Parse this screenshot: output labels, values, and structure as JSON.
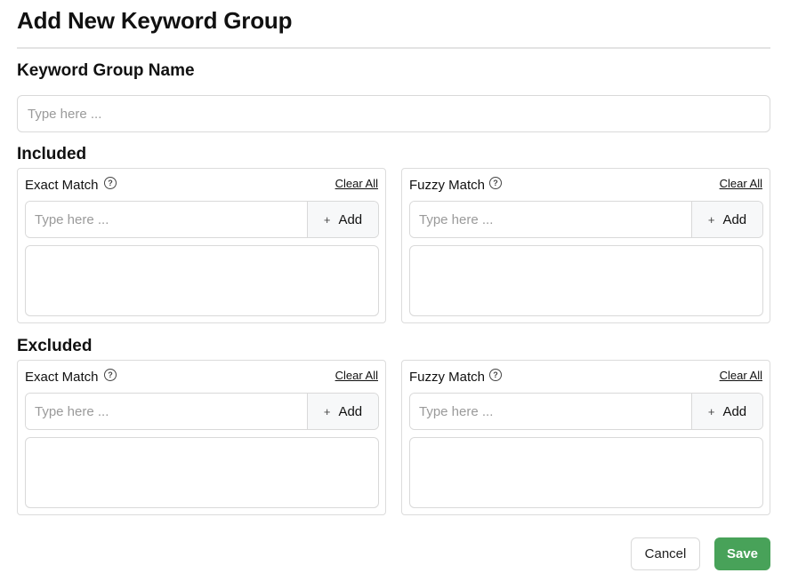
{
  "dialog": {
    "title": "Add New Keyword Group",
    "group_name_label": "Keyword Group Name",
    "group_name_placeholder": "Type here ...",
    "group_name_value": ""
  },
  "sections": {
    "included": {
      "title": "Included",
      "exact": {
        "title": "Exact Match",
        "help_icon": "question-circle-icon",
        "clear_label": "Clear All",
        "placeholder": "Type here ...",
        "add_label": "Add",
        "add_icon": "plus-icon"
      },
      "fuzzy": {
        "title": "Fuzzy Match",
        "help_icon": "question-circle-icon",
        "clear_label": "Clear All",
        "placeholder": "Type here ...",
        "add_label": "Add",
        "add_icon": "plus-icon"
      }
    },
    "excluded": {
      "title": "Excluded",
      "exact": {
        "title": "Exact Match",
        "help_icon": "question-circle-icon",
        "clear_label": "Clear All",
        "placeholder": "Type here ...",
        "add_label": "Add",
        "add_icon": "plus-icon"
      },
      "fuzzy": {
        "title": "Fuzzy Match",
        "help_icon": "question-circle-icon",
        "clear_label": "Clear All",
        "placeholder": "Type here ...",
        "add_label": "Add",
        "add_icon": "plus-icon"
      }
    }
  },
  "footer": {
    "cancel_label": "Cancel",
    "save_label": "Save"
  },
  "colors": {
    "save_button": "#48a259",
    "border": "#d9d9d9"
  }
}
